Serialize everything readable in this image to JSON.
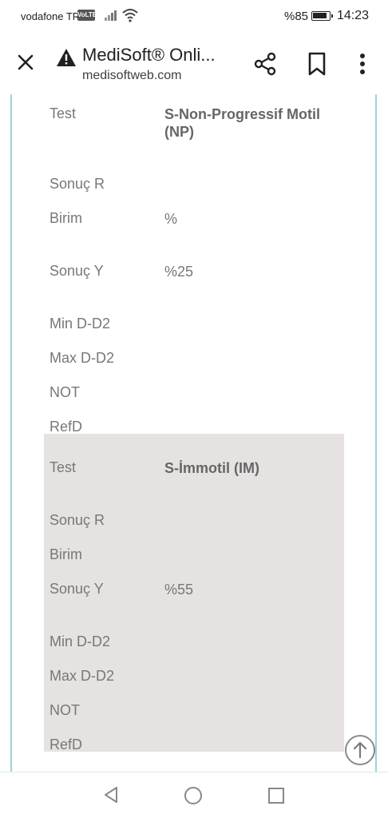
{
  "status_bar": {
    "carrier": "vodafone TR",
    "volte": "VoLTE",
    "battery_percent": "%85",
    "time": "14:23"
  },
  "browser": {
    "title": "MediSoft® Onli...",
    "url": "medisoftweb.com",
    "icons": [
      "close-icon",
      "warning-icon",
      "share-icon",
      "bookmark-icon",
      "more-vert-icon"
    ]
  },
  "results": [
    {
      "test_label": "Test",
      "test_value": "S-Non-Progressif Motil (NP)",
      "sonuc_r_label": "Sonuç R",
      "sonuc_r_value": "",
      "birim_label": "Birim",
      "birim_value": "%",
      "sonuc_y_label": "Sonuç Y",
      "sonuc_y_value": "%25",
      "min_label": "Min D-D2",
      "min_value": "",
      "max_label": "Max D-D2",
      "max_value": "",
      "not_label": "NOT",
      "not_value": "",
      "refd_label": "RefD",
      "refd_value": ""
    },
    {
      "test_label": "Test",
      "test_value": "S-İmmotil (IM)",
      "sonuc_r_label": "Sonuç R",
      "sonuc_r_value": "",
      "birim_label": "Birim",
      "birim_value": "",
      "sonuc_y_label": "Sonuç Y",
      "sonuc_y_value": "%55",
      "min_label": "Min D-D2",
      "min_value": "",
      "max_label": "Max D-D2",
      "max_value": "",
      "not_label": "NOT",
      "not_value": "",
      "refd_label": "RefD",
      "refd_value": ""
    }
  ],
  "colors": {
    "frame_border": "#9ad6d6",
    "shaded_row_bg": "#e6e2e2",
    "label_text": "#777777"
  },
  "nav_bar": {
    "icons": [
      "back-icon",
      "home-icon",
      "recent-apps-icon"
    ]
  }
}
